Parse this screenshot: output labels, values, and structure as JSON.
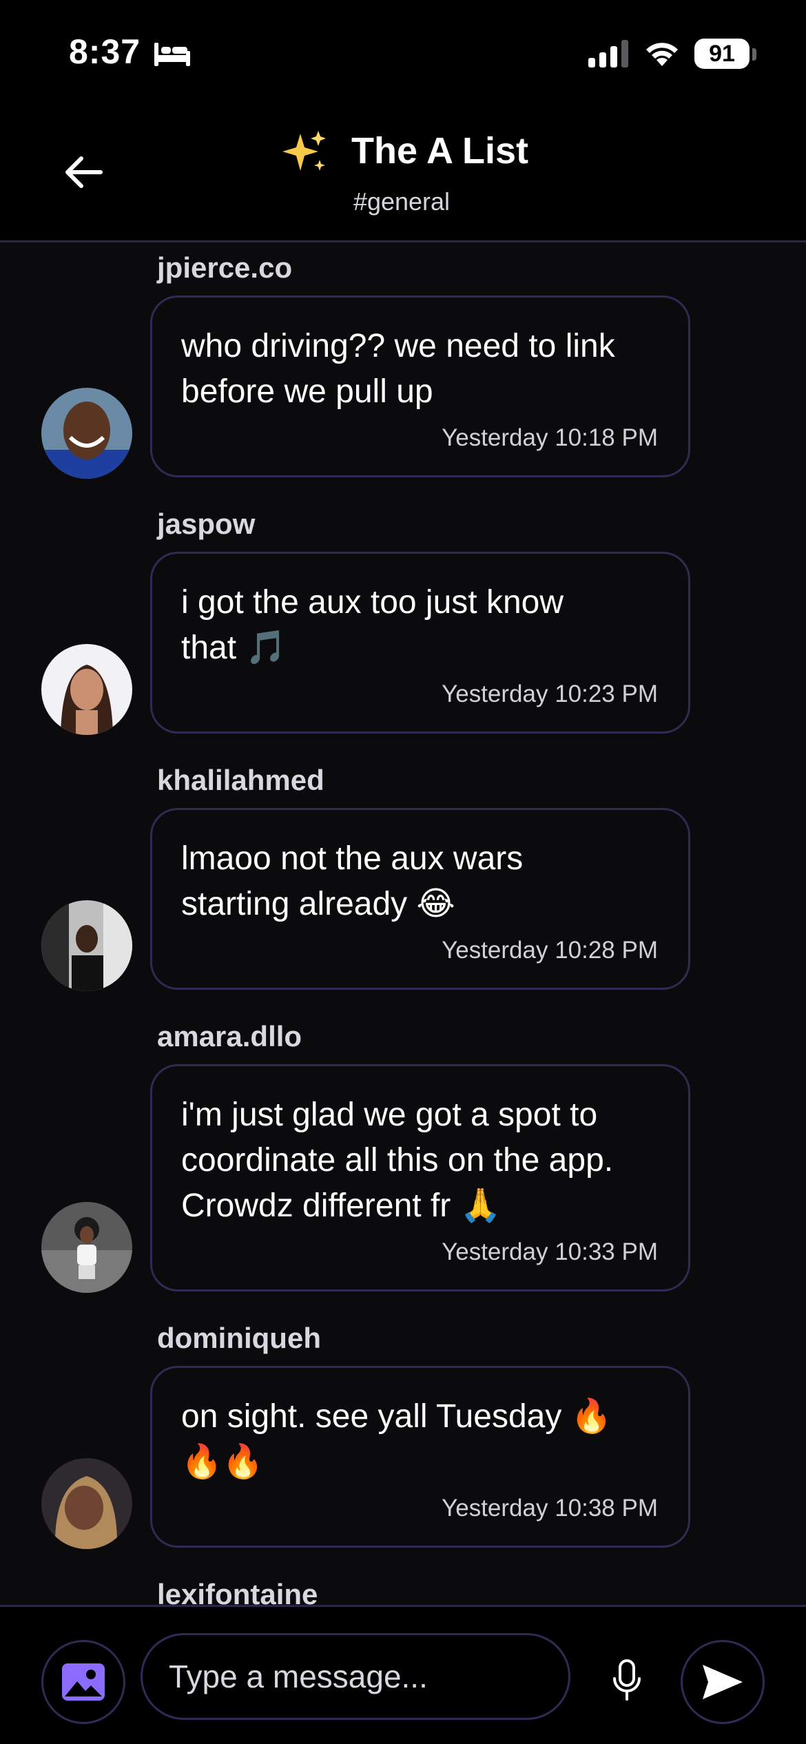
{
  "status_bar": {
    "time": "8:37",
    "battery": "91",
    "icons": [
      "bed-icon",
      "signal-icon",
      "wifi-icon",
      "battery-icon"
    ]
  },
  "header": {
    "back_icon": "arrow-left-icon",
    "emoji": "✨",
    "title": "The A List",
    "channel": "#general"
  },
  "messages": [
    {
      "username": "jpierce.co",
      "line1": "who driving?? we need to link",
      "line2": "before we pull up",
      "line3": "",
      "timestamp": "Yesterday 10:18 PM"
    },
    {
      "username": "jaspow",
      "line1": "i got the aux too just know",
      "line2": "that 🎵",
      "line3": "",
      "timestamp": "Yesterday 10:23 PM"
    },
    {
      "username": "khalilahmed",
      "line1": "lmaoo not the aux wars",
      "line2": "starting already 😂",
      "line3": "",
      "timestamp": "Yesterday 10:28 PM"
    },
    {
      "username": "amara.dllo",
      "line1": "i'm just glad we got a spot to",
      "line2": "coordinate all this on the app.",
      "line3": "Crowdz different fr 🙏",
      "timestamp": "Yesterday 10:33 PM"
    },
    {
      "username": "dominiqueh",
      "line1": "on sight. see yall Tuesday 🔥",
      "line2": "🔥🔥",
      "line3": "",
      "timestamp": "Yesterday 10:38 PM"
    },
    {
      "username": "lexifontaine"
    }
  ],
  "composer": {
    "placeholder": "Type a message...",
    "photo_icon": "image-icon",
    "mic_icon": "microphone-icon",
    "send_icon": "send-icon"
  },
  "colors": {
    "background": "#0b0b0d",
    "bubble_border": "#2f2b55",
    "accent": "#8b6cff",
    "divider": "#2b2749"
  }
}
